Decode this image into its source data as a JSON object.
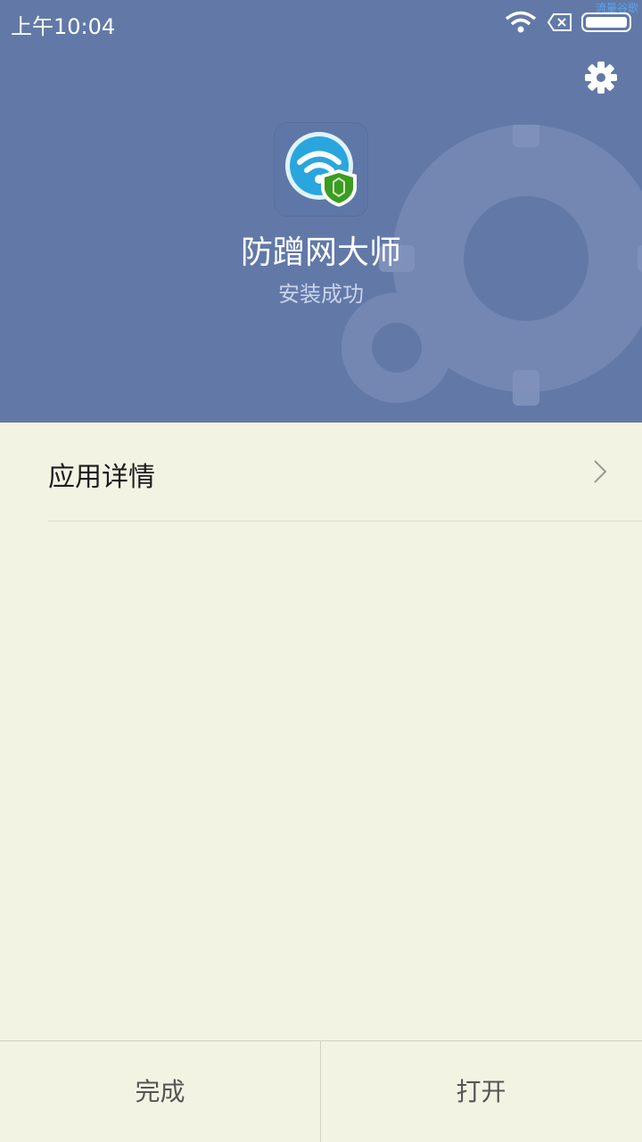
{
  "status_bar": {
    "time": "上午10:04",
    "watermark": "流量谷歌",
    "icons": [
      "wifi-icon",
      "no-sim-icon",
      "battery-icon"
    ]
  },
  "header": {
    "app_name": "防蹭网大师",
    "install_status": "安装成功",
    "settings_icon": "gear-icon",
    "background_color": "#6279a8"
  },
  "details": {
    "label": "应用详情"
  },
  "actions": {
    "done_label": "完成",
    "open_label": "打开"
  }
}
